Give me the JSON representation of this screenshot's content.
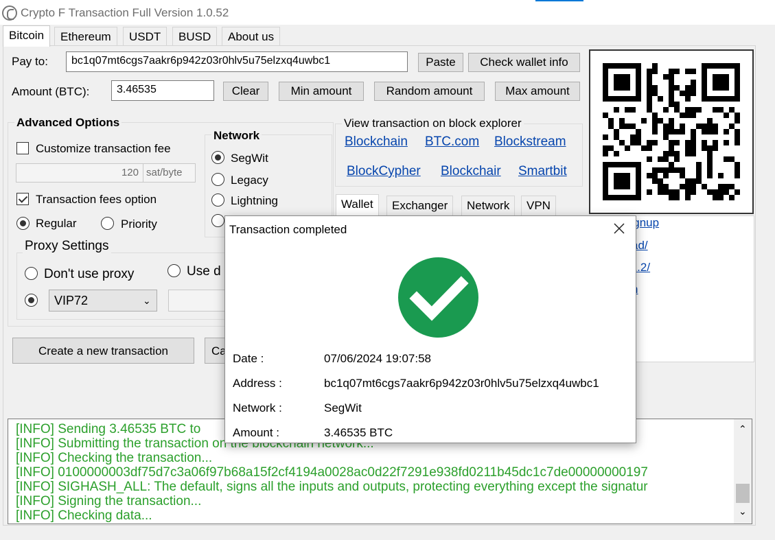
{
  "window": {
    "title": "Crypto F Transaction Full Version 1.0.52"
  },
  "tabs": [
    "Bitcoin",
    "Ethereum",
    "USDT",
    "BUSD",
    "About us"
  ],
  "form": {
    "pay_to_label": "Pay to:",
    "pay_to_value": "bc1q07mt6cgs7aakr6p942z03r0hlv5u75elzxq4uwbc1",
    "paste_label": "Paste",
    "check_wallet_label": "Check wallet info",
    "amount_label": "Amount (BTC):",
    "amount_value": "3.46535",
    "clear_label": "Clear",
    "min_label": "Min amount",
    "random_label": "Random amount",
    "max_label": "Max amount"
  },
  "advanced": {
    "title": "Advanced Options",
    "customize_fee_label": "Customize transaction fee",
    "customize_fee_checked": false,
    "fee_value": "120",
    "fee_unit": "sat/byte",
    "fees_option_label": "Transaction fees option",
    "fees_option_checked": true,
    "regular_label": "Regular",
    "priority_label": "Priority",
    "selected_fee": "Regular"
  },
  "network": {
    "title": "Network",
    "options": [
      "SegWit",
      "Legacy",
      "Lightning"
    ],
    "selected": "SegWit"
  },
  "proxy": {
    "title": "Proxy Settings",
    "dont_use_label": "Don't use proxy",
    "use_label_partial": "Use d",
    "selected_proxy": "VIP72"
  },
  "explorer": {
    "title": "View transaction on block explorer",
    "links_row1": [
      "Blockchain",
      "BTC.com",
      "Blockstream"
    ],
    "links_row2": [
      "BlockCypher",
      "Blockchair",
      "Smartbit"
    ]
  },
  "inner_tabs": [
    "Wallet",
    "Exchanger",
    "Network",
    "VPN"
  ],
  "side_links_partial": [
    "signup",
    "ad/",
    ".1.2/",
    "n",
    "/",
    "/"
  ],
  "actions": {
    "create_label": "Create a new transaction",
    "cancel_partial": "Ca"
  },
  "log": [
    "[INFO]   Sending 3.46535 BTC to",
    "[INFO]   Submitting the transaction on the blockchain network...",
    "[INFO]   Checking the transaction...",
    "[INFO]   0100000003df75d7c3a06f97b68a15f2cf4194a0028ac0d22f7291e938fd0211b45dc1c7de00000000197",
    "[INFO]   SIGHASH_ALL: The default, signs all the inputs and outputs, protecting everything except the signatur",
    "[INFO]   Signing the transaction...",
    "[INFO]   Checking data..."
  ],
  "dialog": {
    "title": "Transaction completed",
    "date_label": "Date :",
    "date_value": "07/06/2024  19:07:58",
    "address_label": "Address :",
    "address_value": "bc1q07mt6cgs7aakr6p942z03r0hlv5u75elzxq4uwbc1",
    "network_label": "Network :",
    "network_value": "SegWit",
    "amount_label": "Amount :",
    "amount_value": "3.46535 BTC"
  },
  "colors": {
    "success_green": "#1a9a50",
    "log_green": "#2ca02c",
    "link_blue": "#0645ad"
  }
}
